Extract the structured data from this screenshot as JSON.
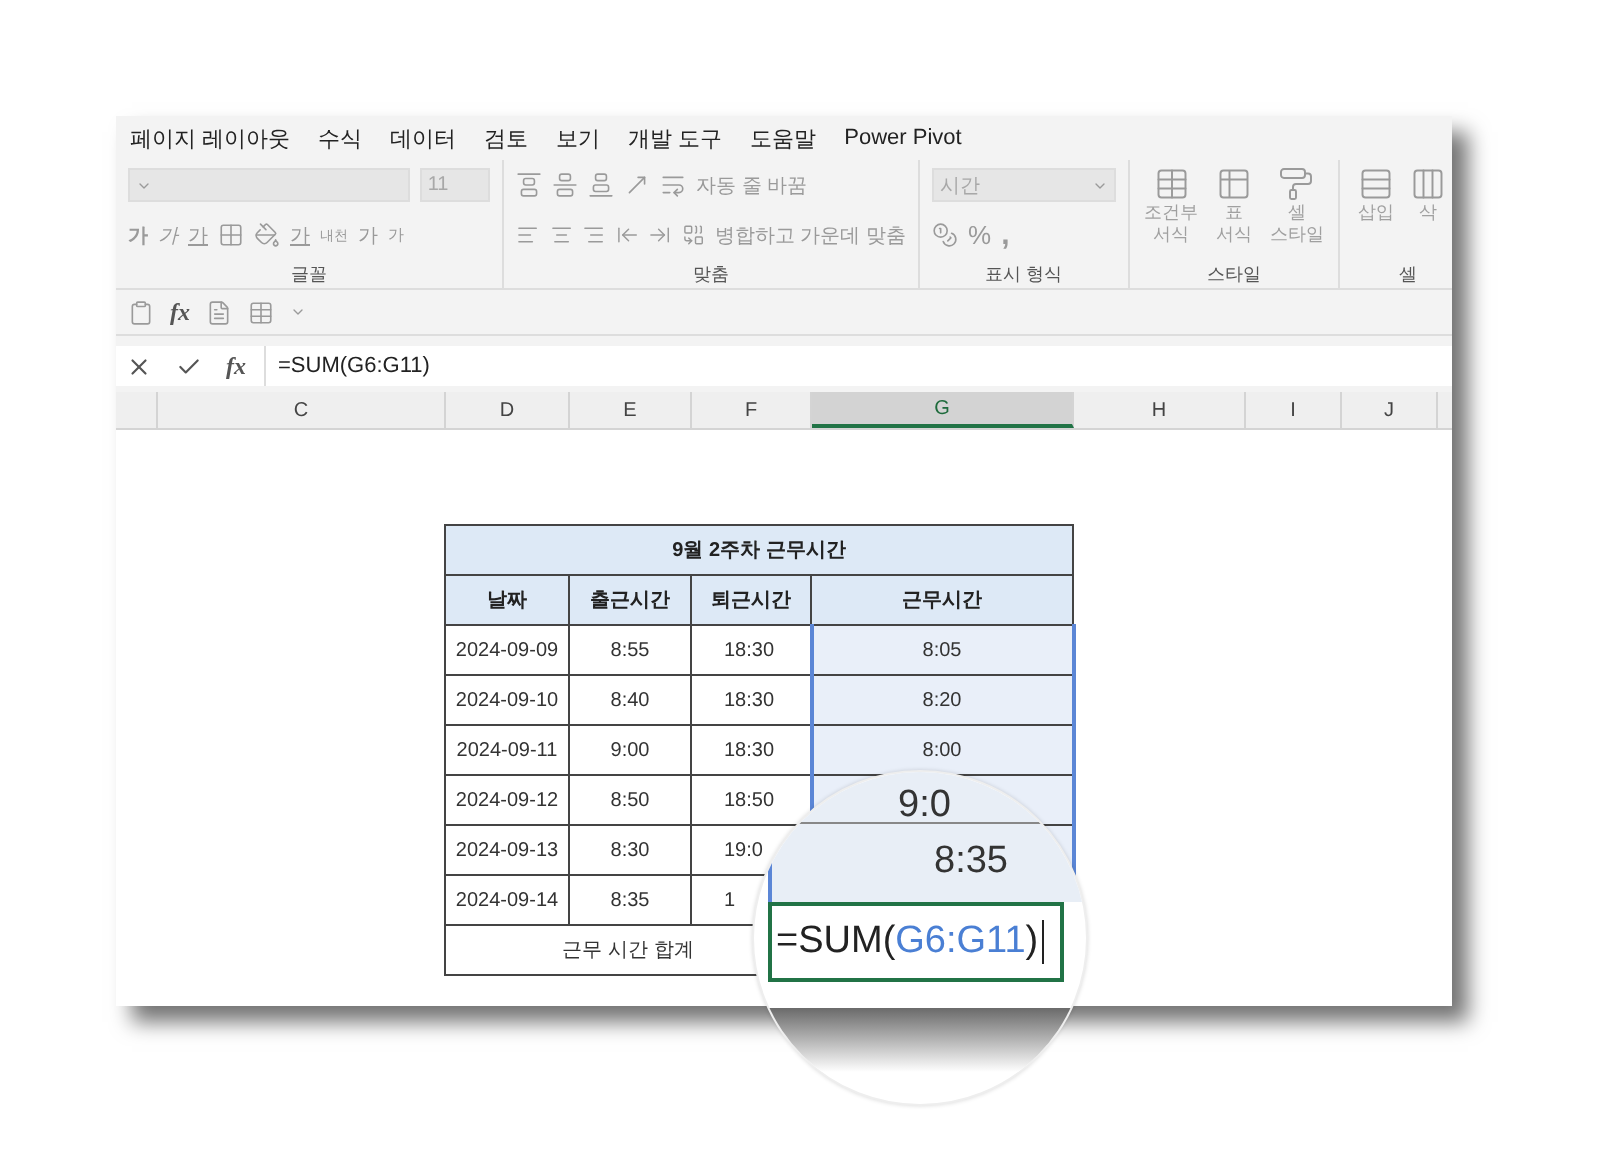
{
  "menu_tabs": [
    "페이지 레이아웃",
    "수식",
    "데이터",
    "검토",
    "보기",
    "개발 도구",
    "도움말",
    "Power Pivot"
  ],
  "ribbon": {
    "font": {
      "label": "글꼴",
      "size": "11",
      "grow": "가",
      "shrink": "가",
      "bold": "가",
      "italic": "가",
      "underline": "가",
      "font_color": "가",
      "phonetic": "내천"
    },
    "align": {
      "label": "맞춤",
      "wrap": "자동 줄 바꿈",
      "merge": "병합하고 가운데 맞춤"
    },
    "number": {
      "label": "표시 형식",
      "format": "시간",
      "percent": "%",
      "comma": ","
    },
    "styles": {
      "label": "스타일",
      "items": [
        {
          "top": "조건부",
          "bottom": "서식"
        },
        {
          "top": "표",
          "bottom": "서식"
        },
        {
          "top": "셀",
          "bottom": "스타일"
        }
      ]
    },
    "cells": {
      "label": "셀",
      "items": [
        "삽입",
        "삭"
      ]
    }
  },
  "quick_access": {
    "fx": "fx"
  },
  "formula_bar": {
    "fx": "fx",
    "formula": "=SUM(G6:G11)"
  },
  "columns": [
    {
      "label": "C",
      "selected": false
    },
    {
      "label": "D",
      "selected": false
    },
    {
      "label": "E",
      "selected": false
    },
    {
      "label": "F",
      "selected": false
    },
    {
      "label": "G",
      "selected": true
    },
    {
      "label": "H",
      "selected": false
    },
    {
      "label": "I",
      "selected": false
    },
    {
      "label": "J",
      "selected": false
    }
  ],
  "table": {
    "title": "9월 2주차 근무시간",
    "headers": [
      "날짜",
      "출근시간",
      "퇴근시간",
      "근무시간"
    ],
    "rows": [
      {
        "cells": [
          "2024-09-09",
          "8:55",
          "18:30",
          "8:05"
        ]
      },
      {
        "cells": [
          "2024-09-10",
          "8:40",
          "18:30",
          "8:20"
        ]
      },
      {
        "cells": [
          "2024-09-11",
          "9:00",
          "18:30",
          "8:00"
        ]
      },
      {
        "cells": [
          "2024-09-12",
          "8:50",
          "18:50"
        ]
      },
      {
        "cells": [
          "2024-09-13",
          "8:30",
          "19:0"
        ]
      },
      {
        "cells": [
          "2024-09-14",
          "8:35",
          "1"
        ]
      }
    ],
    "total_label": "근무 시간 합계"
  },
  "magnifier": {
    "values": [
      "9:0",
      "8:35"
    ],
    "formula_parts": [
      {
        "text": "=SUM(",
        "kind": "plain"
      },
      {
        "text": "G6:G11",
        "kind": "ref"
      },
      {
        "text": ")",
        "kind": "plain"
      }
    ]
  }
}
